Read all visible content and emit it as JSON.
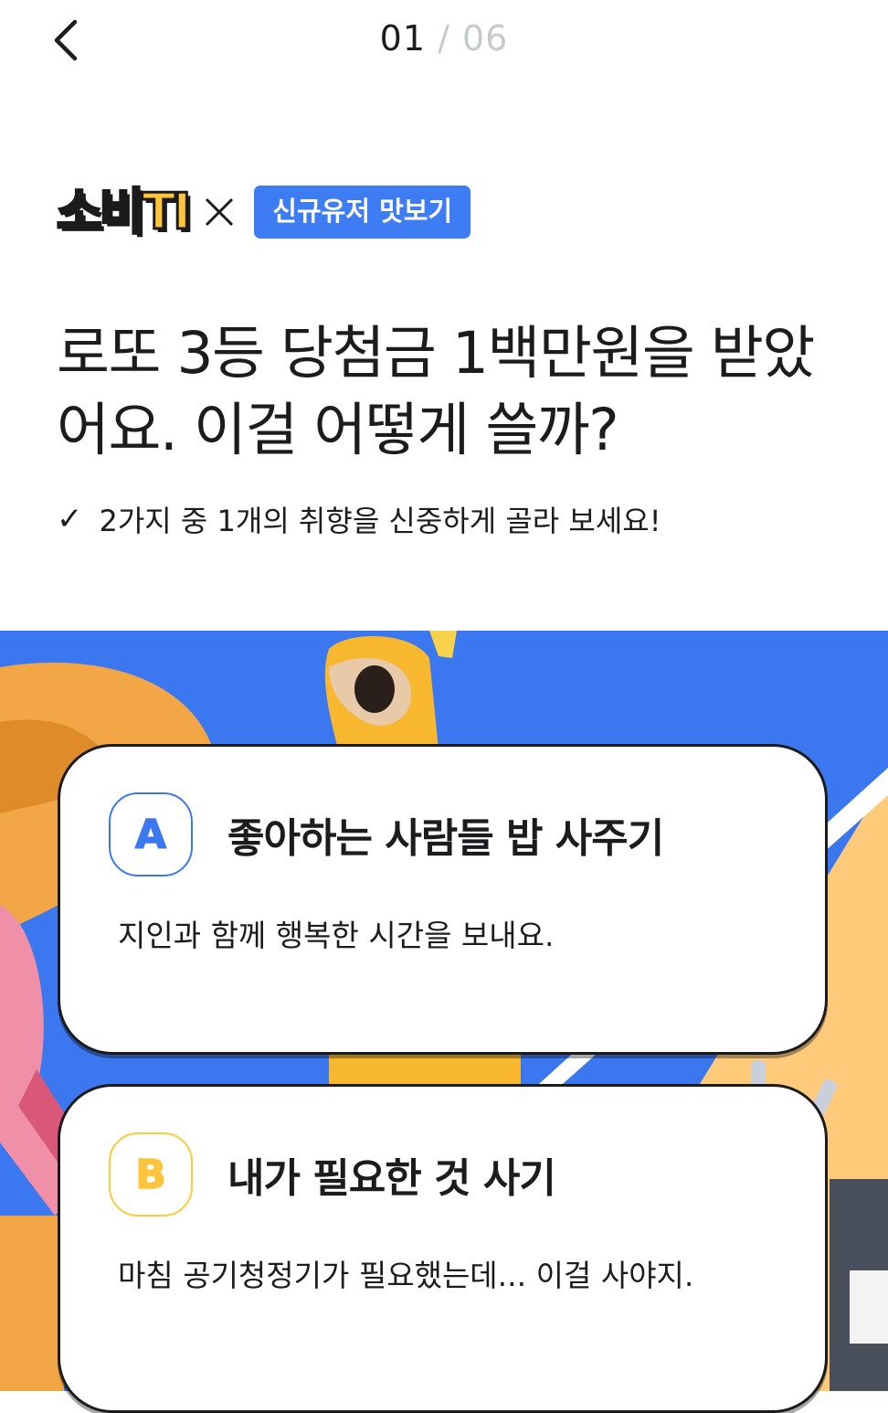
{
  "header": {
    "current_step": "01",
    "separator": "/",
    "total_steps": "06"
  },
  "brand": {
    "logo_text": "소비TI",
    "tag_label": "신규유저 맛보기"
  },
  "question": {
    "text": "로또 3등 당첨금 1백만원을 받았어요. 이걸 어떻게 쓸까?",
    "hint_check": "✓",
    "hint": "2가지 중 1개의 취향을 신중하게 골라 보세요!"
  },
  "options": [
    {
      "badge": "A",
      "title": "좋아하는 사람들 밥 사주기",
      "description": "지인과 함께 행복한 시간을 보내요."
    },
    {
      "badge": "B",
      "title": "내가 필요한 것 사기",
      "description": "마침 공기청정기가 필요했는데... 이걸 사야지."
    }
  ],
  "colors": {
    "accent_blue": "#3b78f0",
    "accent_yellow": "#ffc43b",
    "text_primary": "#1c1c1e",
    "text_muted": "#c7c9cf"
  }
}
